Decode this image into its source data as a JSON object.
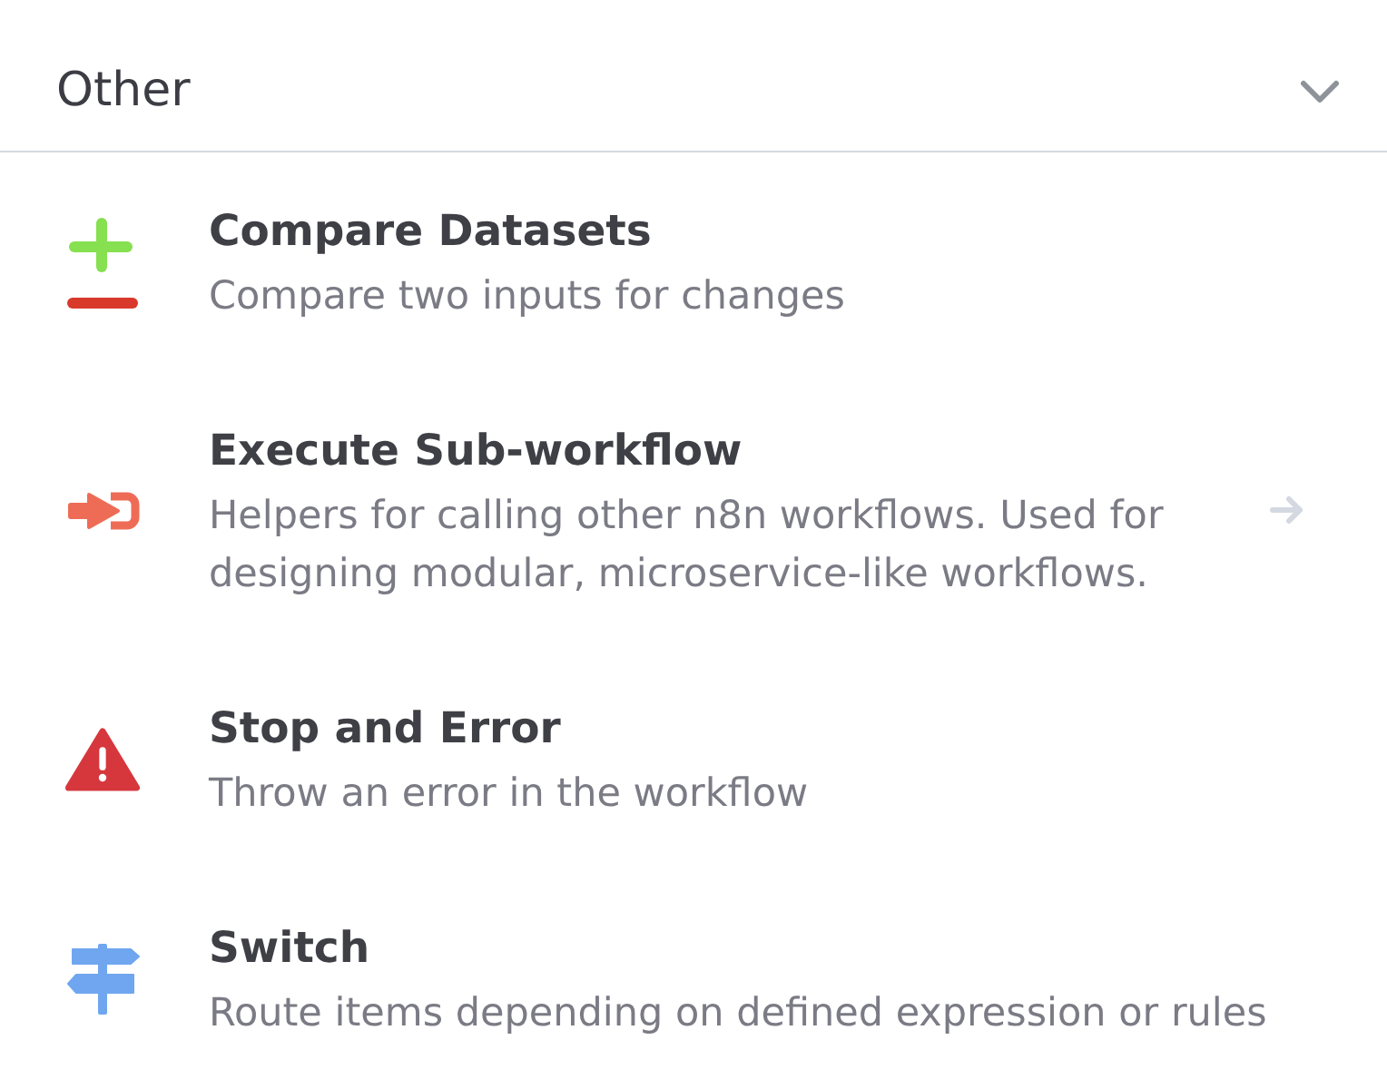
{
  "section": {
    "title": "Other",
    "expanded": true
  },
  "nodes": [
    {
      "title": "Compare Datasets",
      "description": "Compare two inputs for changes",
      "has_subcategory": false
    },
    {
      "title": "Execute Sub-workflow",
      "description": "Helpers for calling other n8n workflows. Used for designing modular, microservice-like workflows.",
      "has_subcategory": true
    },
    {
      "title": "Stop and Error",
      "description": "Throw an error in the workflow",
      "has_subcategory": false
    },
    {
      "title": "Switch",
      "description": "Route items depending on defined expression or rules",
      "has_subcategory": false
    }
  ]
}
